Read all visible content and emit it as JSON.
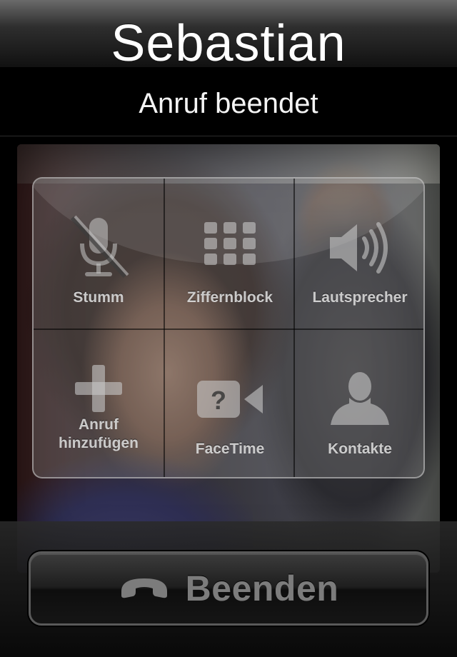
{
  "call": {
    "caller_name": "Sebastian",
    "status": "Anruf beendet"
  },
  "controls": [
    {
      "id": "mute",
      "label": "Stumm",
      "icon": "microphone-muted-icon"
    },
    {
      "id": "keypad",
      "label": "Ziffernblock",
      "icon": "keypad-icon"
    },
    {
      "id": "speaker",
      "label": "Lautsprecher",
      "icon": "speaker-icon"
    },
    {
      "id": "add_call",
      "label_line1": "Anruf",
      "label_line2": "hinzufügen",
      "icon": "plus-icon"
    },
    {
      "id": "facetime",
      "label": "FaceTime",
      "icon": "facetime-question-icon"
    },
    {
      "id": "contacts",
      "label": "Kontakte",
      "icon": "contact-person-icon"
    }
  ],
  "end_button": {
    "label": "Beenden",
    "icon": "phone-handset-icon"
  },
  "colors": {
    "end_label": "#7c7c7c",
    "control_label": "#f0f0f0"
  }
}
